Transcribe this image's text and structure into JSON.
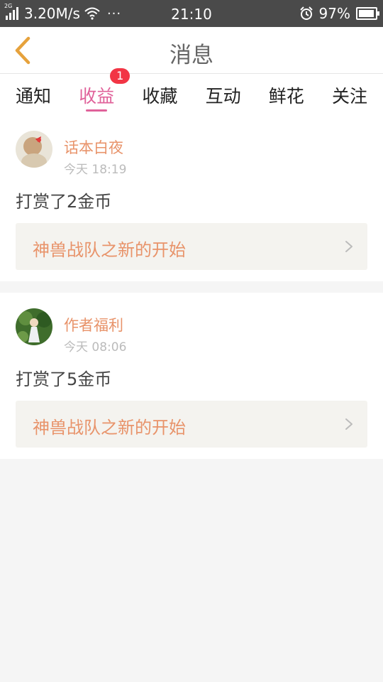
{
  "status_bar": {
    "network_tag": "2G",
    "speed": "3.20M/s",
    "dots": "···",
    "time": "21:10",
    "battery_percent": "97%",
    "battery_level": 0.97
  },
  "nav": {
    "title": "消息",
    "back_icon": "chevron-left-icon"
  },
  "tabs": [
    {
      "label": "通知",
      "active": false
    },
    {
      "label": "收益",
      "active": true,
      "badge": "1"
    },
    {
      "label": "收藏",
      "active": false
    },
    {
      "label": "互动",
      "active": false
    },
    {
      "label": "鲜花",
      "active": false
    },
    {
      "label": "关注",
      "active": false
    }
  ],
  "messages": [
    {
      "user": "话本白夜",
      "time": "今天 18:19",
      "text": "打赏了2金币",
      "book": "神兽战队之新的开始"
    },
    {
      "user": "作者福利",
      "time": "今天 08:06",
      "text": "打赏了5金币",
      "book": "神兽战队之新的开始"
    }
  ],
  "colors": {
    "accent": "#e0629a",
    "badge": "#f23545",
    "name": "#e8936a",
    "back_arrow": "#e6a23c"
  }
}
